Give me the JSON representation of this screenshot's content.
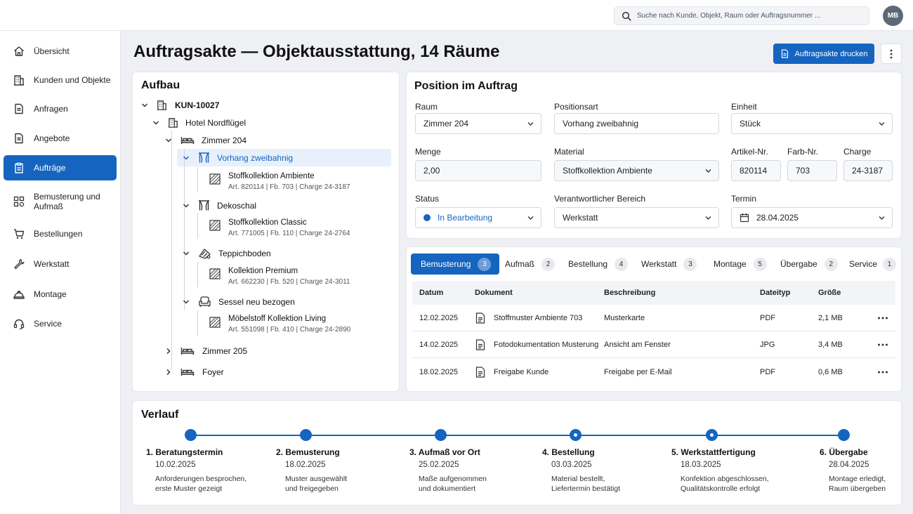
{
  "search": {
    "placeholder": "Suche nach Kunde, Objekt, Raum oder Auftragsnummer ..."
  },
  "user": {
    "initials": "MB"
  },
  "sidebar": {
    "items": [
      {
        "label": "Übersicht",
        "icon": "home-icon"
      },
      {
        "label": "Kunden und Objekte",
        "icon": "building-icon"
      },
      {
        "label": "Anfragen",
        "icon": "document-icon"
      },
      {
        "label": "Angebote",
        "icon": "document-icon"
      },
      {
        "label": "Aufträge",
        "icon": "clipboard-icon",
        "active": true
      },
      {
        "label": "Bemusterung und Aufmaß",
        "icon": "swatch-icon"
      },
      {
        "label": "Bestellungen",
        "icon": "cart-icon"
      },
      {
        "label": "Werkstatt",
        "icon": "wrench-icon"
      },
      {
        "label": "Montage",
        "icon": "helmet-icon"
      },
      {
        "label": "Service",
        "icon": "headset-icon"
      }
    ]
  },
  "page": {
    "title": "Auftragsakte — Objektausstattung, 14 Räume",
    "print_label": "Auftragsakte drucken"
  },
  "tree": {
    "title": "Aufbau",
    "customer": "KUN-10027",
    "object": "Hotel Nordflügel",
    "room_open": "Zimmer 204",
    "positions": [
      {
        "label": "Vorhang zweibahnig",
        "material": "Stoffkollektion Ambiente",
        "meta": "Art. 820114  |  Fb. 703  |  Charge 24-3187"
      },
      {
        "label": "Dekoschal",
        "material": "Stoffkollektion Classic",
        "meta": "Art. 771005  |  Fb. 110  |  Charge 24-2764"
      },
      {
        "label": "Teppichboden",
        "material": "Kollektion Premium",
        "meta": "Art. 662230  |  Fb. 520  |  Charge 24-3011"
      },
      {
        "label": "Sessel neu bezogen",
        "material": "Möbelstoff Kollektion Living",
        "meta": "Art. 551098  |  Fb. 410  |  Charge 24-2890"
      }
    ],
    "rooms_closed": [
      "Zimmer 205",
      "Foyer"
    ]
  },
  "position": {
    "title": "Position im Auftrag",
    "raum": {
      "label": "Raum",
      "value": "Zimmer 204"
    },
    "positionsart": {
      "label": "Positionsart",
      "value": "Vorhang zweibahnig"
    },
    "einheit": {
      "label": "Einheit",
      "value": "Stück"
    },
    "menge": {
      "label": "Menge",
      "value": "2,00"
    },
    "material": {
      "label": "Material",
      "value": "Stoffkollektion Ambiente"
    },
    "artikel": {
      "label": "Artikel-Nr.",
      "value": "820114"
    },
    "farb": {
      "label": "Farb-Nr.",
      "value": "703"
    },
    "charge": {
      "label": "Charge",
      "value": "24-3187"
    },
    "status": {
      "label": "Status",
      "value": "In Bearbeitung",
      "color": "#1565c0"
    },
    "bereich": {
      "label": "Verantwortlicher Bereich",
      "value": "Werkstatt"
    },
    "termin": {
      "label": "Termin",
      "value": "28.04.2025"
    }
  },
  "tabs": [
    {
      "label": "Bemusterung",
      "count": "3",
      "active": true
    },
    {
      "label": "Aufmaß",
      "count": "2"
    },
    {
      "label": "Bestellung",
      "count": "4"
    },
    {
      "label": "Werkstatt",
      "count": "3"
    },
    {
      "label": "Montage",
      "count": "5"
    },
    {
      "label": "Übergabe",
      "count": "2"
    },
    {
      "label": "Service",
      "count": "1"
    }
  ],
  "table": {
    "headers": {
      "datum": "Datum",
      "dokument": "Dokument",
      "beschreibung": "Beschreibung",
      "dateityp": "Dateityp",
      "groesse": "Größe"
    },
    "rows": [
      {
        "datum": "12.02.2025",
        "dokument": "Stoffmuster Ambiente 703",
        "beschreibung": "Musterkarte",
        "dateityp": "PDF",
        "groesse": "2,1 MB"
      },
      {
        "datum": "14.02.2025",
        "dokument": "Fotodokumentation Musterung",
        "beschreibung": "Ansicht am Fenster",
        "dateityp": "JPG",
        "groesse": "3,4 MB"
      },
      {
        "datum": "18.02.2025",
        "dokument": "Freigabe Kunde",
        "beschreibung": "Freigabe per E-Mail",
        "dateityp": "PDF",
        "groesse": "0,6 MB"
      }
    ]
  },
  "timeline": {
    "title": "Verlauf",
    "steps": [
      {
        "title": "1. Beratungstermin",
        "date": "10.02.2025",
        "desc1": "Anforderungen besprochen,",
        "desc2": "erste Muster gezeigt"
      },
      {
        "title": "2. Bemusterung",
        "date": "18.02.2025",
        "desc1": "Muster ausgewählt",
        "desc2": "und freigegeben"
      },
      {
        "title": "3. Aufmaß vor Ort",
        "date": "25.02.2025",
        "desc1": "Maße aufgenommen",
        "desc2": "und dokumentiert"
      },
      {
        "title": "4. Bestellung",
        "date": "03.03.2025",
        "desc1": "Material bestellt,",
        "desc2": "Liefertermin bestätigt"
      },
      {
        "title": "5. Werkstattfertigung",
        "date": "18.03.2025",
        "desc1": "Konfektion abgeschlossen,",
        "desc2": "Qualitätskontrolle erfolgt"
      },
      {
        "title": "6. Übergabe",
        "date": "28.04.2025",
        "desc1": "Montage erledigt,",
        "desc2": "Raum übergeben"
      }
    ]
  },
  "colors": {
    "primary": "#1565c0",
    "background": "#eef0f3"
  }
}
